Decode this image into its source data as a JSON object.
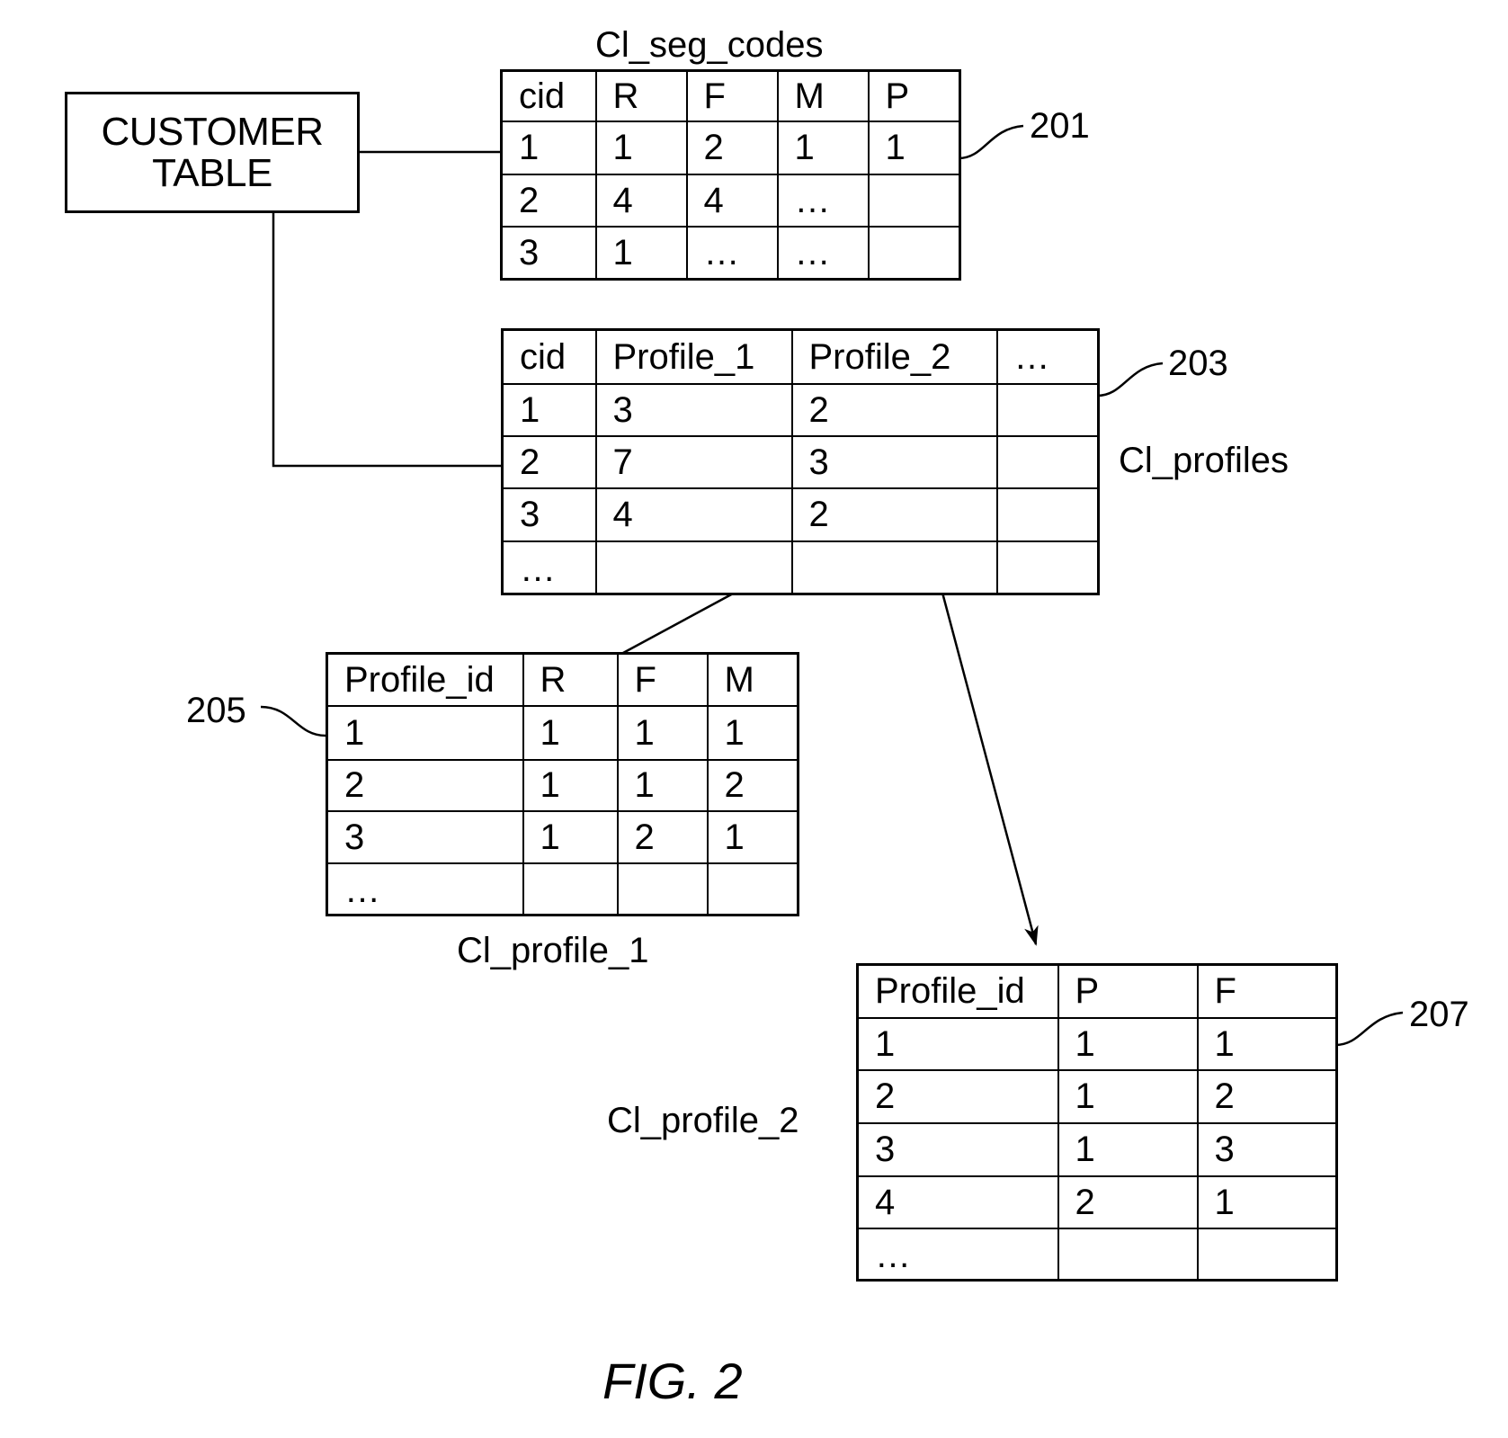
{
  "figure_label": "FIG. 2",
  "customer_table": {
    "label": "CUSTOMER\nTABLE"
  },
  "tables": {
    "seg_codes": {
      "name": "Cl_seg_codes",
      "ref": "201",
      "headers": [
        "cid",
        "R",
        "F",
        "M",
        "P"
      ],
      "rows": [
        [
          "1",
          "1",
          "2",
          "1",
          "1"
        ],
        [
          "2",
          "4",
          "4",
          "...",
          ""
        ],
        [
          "3",
          "1",
          "...",
          "...",
          ""
        ]
      ]
    },
    "profiles": {
      "name": "Cl_profiles",
      "ref": "203",
      "headers": [
        "cid",
        "Profile_1",
        "Profile_2",
        "..."
      ],
      "rows": [
        [
          "1",
          "3",
          "2",
          ""
        ],
        [
          "2",
          "7",
          "3",
          ""
        ],
        [
          "3",
          "4",
          "2",
          ""
        ],
        [
          "...",
          "",
          "",
          ""
        ]
      ]
    },
    "profile_1": {
      "name": "Cl_profile_1",
      "ref": "205",
      "headers": [
        "Profile_id",
        "R",
        "F",
        "M"
      ],
      "rows": [
        [
          "1",
          "1",
          "1",
          "1"
        ],
        [
          "2",
          "1",
          "1",
          "2"
        ],
        [
          "3",
          "1",
          "2",
          "1"
        ],
        [
          "...",
          "",
          "",
          ""
        ]
      ]
    },
    "profile_2": {
      "name": "Cl_profile_2",
      "ref": "207",
      "headers": [
        "Profile_id",
        "P",
        "F"
      ],
      "rows": [
        [
          "1",
          "1",
          "1"
        ],
        [
          "2",
          "1",
          "2"
        ],
        [
          "3",
          "1",
          "3"
        ],
        [
          "4",
          "2",
          "1"
        ],
        [
          "...",
          "",
          ""
        ]
      ]
    }
  }
}
